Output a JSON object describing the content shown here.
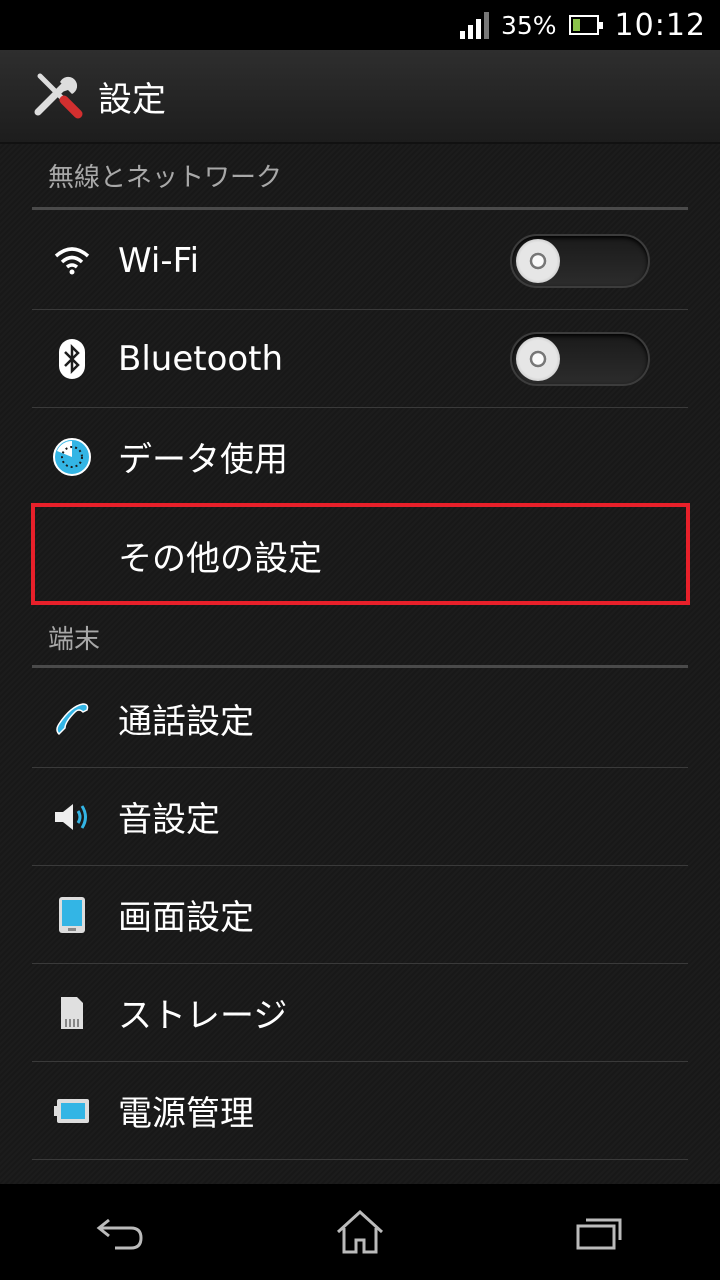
{
  "status_bar": {
    "battery_percent": "35%",
    "battery_level": 0.35,
    "time": "10:12"
  },
  "action_bar": {
    "title": "設定",
    "icon": "settings-tools-icon"
  },
  "sections": {
    "wireless": {
      "header": "無線とネットワーク",
      "items": [
        {
          "label": "Wi-Fi",
          "icon": "wifi-icon",
          "toggle": "off"
        },
        {
          "label": "Bluetooth",
          "icon": "bluetooth-icon",
          "toggle": "off"
        },
        {
          "label": "データ使用",
          "icon": "data-usage-icon"
        },
        {
          "label": "その他の設定",
          "icon": "none",
          "highlighted": true
        }
      ]
    },
    "device": {
      "header": "端末",
      "items": [
        {
          "label": "通話設定",
          "icon": "phone-icon"
        },
        {
          "label": "音設定",
          "icon": "speaker-icon"
        },
        {
          "label": "画面設定",
          "icon": "display-icon"
        },
        {
          "label": "ストレージ",
          "icon": "sd-card-icon"
        },
        {
          "label": "電源管理",
          "icon": "battery-icon"
        }
      ]
    }
  },
  "colors": {
    "highlight": "#e8202a",
    "accent": "#33b5e5"
  },
  "nav_bar": {
    "buttons": [
      "back-icon",
      "home-icon",
      "recent-apps-icon"
    ]
  }
}
